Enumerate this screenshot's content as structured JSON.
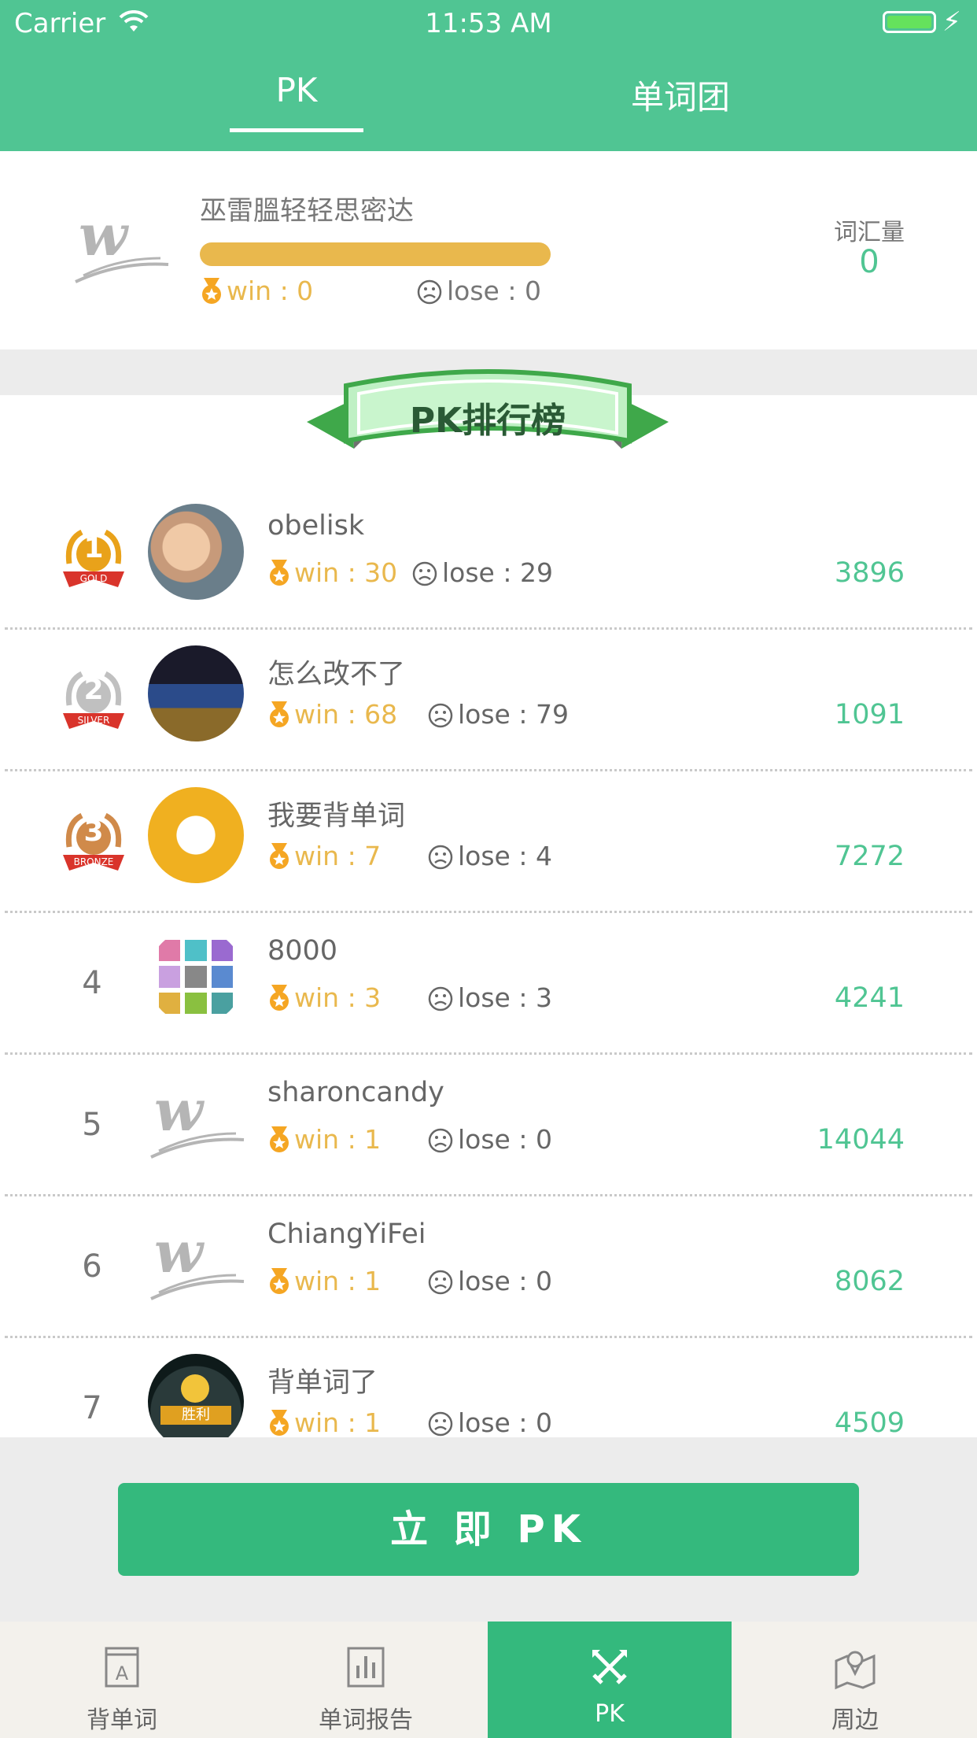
{
  "status": {
    "carrier": "Carrier",
    "time": "11:53 AM"
  },
  "tabs": {
    "pk": "PK",
    "team": "单词团"
  },
  "profile": {
    "name": "巫雷膃轻轻思密达",
    "win_label": "win : 0",
    "lose_label": "lose : 0",
    "vocab_label": "词汇量",
    "vocab_value": "0"
  },
  "banner": {
    "title": "PK排行榜"
  },
  "leaderboard": [
    {
      "rank": "1",
      "name": "obelisk",
      "win": "win : 30",
      "lose": "lose : 29",
      "score": "3896"
    },
    {
      "rank": "2",
      "name": "怎么改不了",
      "win": "win : 68",
      "lose": "lose : 79",
      "score": "1091"
    },
    {
      "rank": "3",
      "name": "我要背单词",
      "win": "win : 7",
      "lose": "lose : 4",
      "score": "7272"
    },
    {
      "rank": "4",
      "name": "8000",
      "win": "win : 3",
      "lose": "lose : 3",
      "score": "4241"
    },
    {
      "rank": "5",
      "name": "sharoncandy",
      "win": "win : 1",
      "lose": "lose : 0",
      "score": "14044"
    },
    {
      "rank": "6",
      "name": "ChiangYiFei",
      "win": "win : 1",
      "lose": "lose : 0",
      "score": "8062"
    },
    {
      "rank": "7",
      "name": "背单词了",
      "win": "win : 1",
      "lose": "lose : 0",
      "score": "4509"
    }
  ],
  "medals": {
    "gold": "GOLD",
    "silver": "SILVER",
    "bronze": "BRONZE"
  },
  "avatar_text": {
    "victory": "胜利"
  },
  "pk_button": "立 即 PK",
  "nav": [
    {
      "label": "背单词",
      "icon": "word-card-icon"
    },
    {
      "label": "单词报告",
      "icon": "bar-chart-icon"
    },
    {
      "label": "PK",
      "icon": "crossed-swords-icon"
    },
    {
      "label": "周边",
      "icon": "map-pin-icon"
    }
  ],
  "colors": {
    "primary": "#50c593",
    "button": "#34b97d",
    "gold": "#e9b84d"
  }
}
